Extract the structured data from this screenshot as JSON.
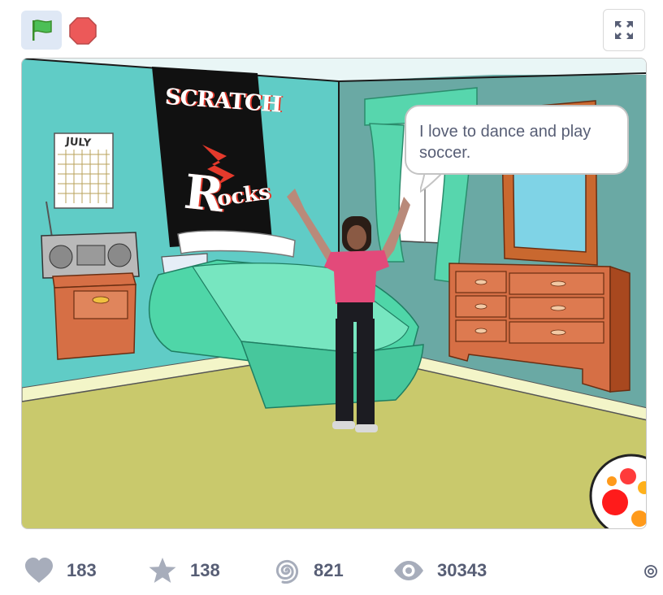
{
  "toolbar": {
    "flag_icon": "green-flag-icon",
    "stop_icon": "stop-sign-icon",
    "fullscreen_icon": "fullscreen-icon"
  },
  "stage": {
    "poster_line1": "SCRATCH",
    "poster_line2": "R",
    "poster_line3": "ocks",
    "calendar_month": "JULY",
    "speech": "I love to dance and play soccer."
  },
  "stats": {
    "loves": "183",
    "favorites": "138",
    "remixes": "821",
    "views": "30343"
  },
  "colors": {
    "wall": "#5ecfc8",
    "floor": "#c8c86a",
    "bed": "#4fd6a8",
    "dresser": "#d9744a",
    "text": "#575e75"
  }
}
